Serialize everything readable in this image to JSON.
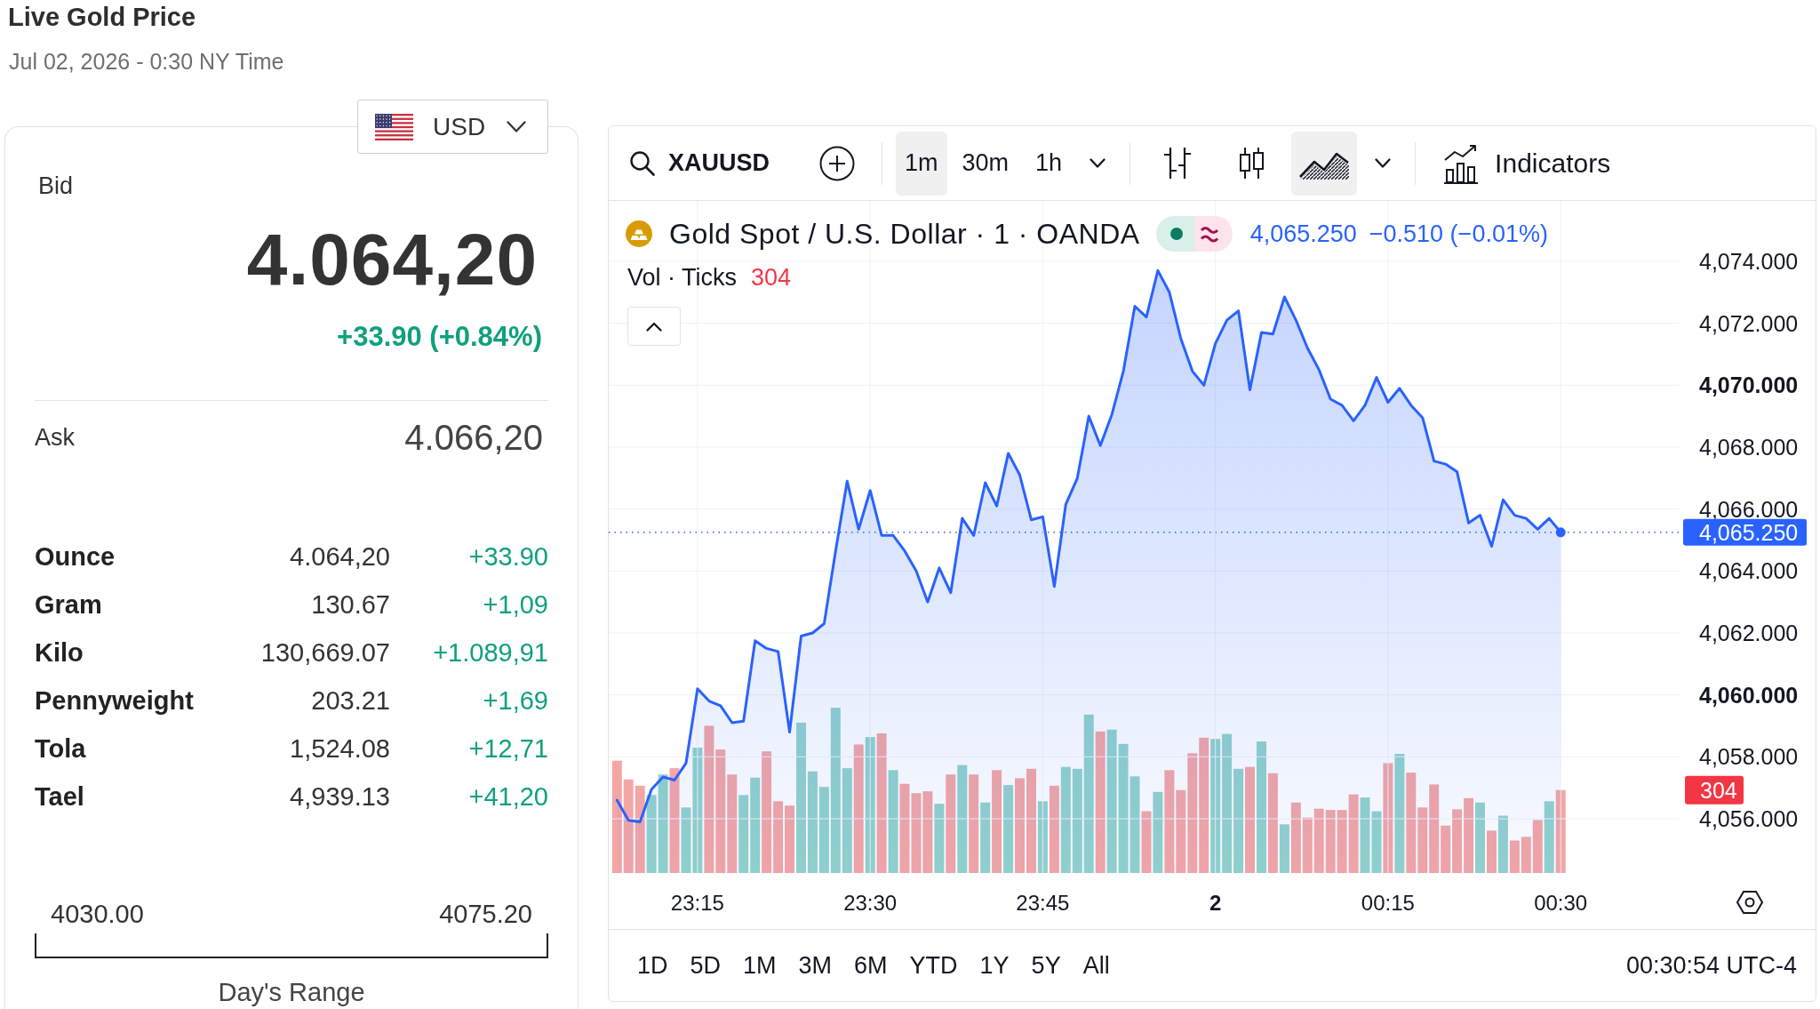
{
  "header": {
    "title": "Live Gold Price",
    "timestamp": "Jul 02, 2026 - 0:30 NY Time"
  },
  "currency": {
    "code": "USD"
  },
  "quote": {
    "bid_label": "Bid",
    "bid": "4.064,20",
    "change": "+33.90 (+0.84%)",
    "positive": true,
    "ask_label": "Ask",
    "ask": "4.066,20"
  },
  "units": [
    {
      "unit": "Ounce",
      "price": "4.064,20",
      "change": "+33.90",
      "positive": true
    },
    {
      "unit": "Gram",
      "price": "130.67",
      "change": "+1,09",
      "positive": true
    },
    {
      "unit": "Kilo",
      "price": "130,669.07",
      "change": "+1.089,91",
      "positive": true
    },
    {
      "unit": "Pennyweight",
      "price": "203.21",
      "change": "+1,69",
      "positive": true
    },
    {
      "unit": "Tola",
      "price": "1,524.08",
      "change": "+12,71",
      "positive": true
    },
    {
      "unit": "Tael",
      "price": "4,939.13",
      "change": "+41,20",
      "positive": true
    }
  ],
  "day_range": {
    "low": "4030.00",
    "high": "4075.20",
    "label": "Day's Range"
  },
  "chart": {
    "toolbar": {
      "symbol": "XAUUSD",
      "intervals": [
        {
          "label": "1m",
          "selected": true
        },
        {
          "label": "30m",
          "selected": false
        },
        {
          "label": "1h",
          "selected": false
        }
      ],
      "chart_types": [
        {
          "kind": "bars",
          "selected": false
        },
        {
          "kind": "candles",
          "selected": false
        },
        {
          "kind": "area",
          "selected": true
        }
      ],
      "indicators": "Indicators"
    },
    "legend": {
      "title": "Gold Spot / U.S. Dollar · 1 · OANDA",
      "price": "4,065.250",
      "change": "−0.510 (−0.01%)"
    },
    "volume_legend": {
      "label": "Vol · Ticks",
      "value": "304"
    },
    "price_tag": "4,065.250",
    "volume_tag": "304",
    "chart_data": {
      "type": "area",
      "x": [
        "2026-07-01T23:08",
        "2026-07-01T23:09",
        "2026-07-01T23:10",
        "2026-07-01T23:11",
        "2026-07-01T23:12",
        "2026-07-01T23:13",
        "2026-07-01T23:14",
        "2026-07-01T23:15",
        "2026-07-01T23:16",
        "2026-07-01T23:17",
        "2026-07-01T23:18",
        "2026-07-01T23:19",
        "2026-07-01T23:20",
        "2026-07-01T23:21",
        "2026-07-01T23:22",
        "2026-07-01T23:23",
        "2026-07-01T23:24",
        "2026-07-01T23:25",
        "2026-07-01T23:26",
        "2026-07-01T23:27",
        "2026-07-01T23:28",
        "2026-07-01T23:29",
        "2026-07-01T23:30",
        "2026-07-01T23:31",
        "2026-07-01T23:32",
        "2026-07-01T23:33",
        "2026-07-01T23:34",
        "2026-07-01T23:35",
        "2026-07-01T23:36",
        "2026-07-01T23:37",
        "2026-07-01T23:38",
        "2026-07-01T23:39",
        "2026-07-01T23:40",
        "2026-07-01T23:41",
        "2026-07-01T23:42",
        "2026-07-01T23:43",
        "2026-07-01T23:44",
        "2026-07-01T23:45",
        "2026-07-01T23:46",
        "2026-07-01T23:47",
        "2026-07-01T23:48",
        "2026-07-01T23:49",
        "2026-07-01T23:50",
        "2026-07-01T23:51",
        "2026-07-01T23:52",
        "2026-07-01T23:53",
        "2026-07-01T23:54",
        "2026-07-01T23:55",
        "2026-07-01T23:56",
        "2026-07-01T23:57",
        "2026-07-01T23:58",
        "2026-07-01T23:59",
        "2026-07-02T00:00",
        "2026-07-02T00:01",
        "2026-07-02T00:02",
        "2026-07-02T00:03",
        "2026-07-02T00:04",
        "2026-07-02T00:05",
        "2026-07-02T00:06",
        "2026-07-02T00:07",
        "2026-07-02T00:08",
        "2026-07-02T00:09",
        "2026-07-02T00:10",
        "2026-07-02T00:11",
        "2026-07-02T00:12",
        "2026-07-02T00:13",
        "2026-07-02T00:14",
        "2026-07-02T00:15",
        "2026-07-02T00:16",
        "2026-07-02T00:17",
        "2026-07-02T00:18",
        "2026-07-02T00:19",
        "2026-07-02T00:20",
        "2026-07-02T00:21",
        "2026-07-02T00:22",
        "2026-07-02T00:23",
        "2026-07-02T00:24",
        "2026-07-02T00:25",
        "2026-07-02T00:26",
        "2026-07-02T00:27",
        "2026-07-02T00:28",
        "2026-07-02T00:29",
        "2026-07-02T00:30"
      ],
      "series": [
        {
          "color": "#2962ff",
          "values": [
            4056.6,
            4055.95,
            4055.9,
            4056.95,
            4057.35,
            4057.25,
            4057.8,
            4060.2,
            4059.8,
            4059.65,
            4059.1,
            4059.15,
            4061.75,
            4061.5,
            4061.4,
            4058.8,
            4061.9,
            4062.0,
            4062.3,
            4064.65,
            4066.9,
            4065.35,
            4066.6,
            4065.15,
            4065.15,
            4064.65,
            4064.0,
            4063.0,
            4064.1,
            4063.3,
            4065.7,
            4065.15,
            4066.85,
            4066.1,
            4067.8,
            4067.1,
            4065.65,
            4065.75,
            4063.5,
            4066.15,
            4067.0,
            4069.0,
            4068.05,
            4069.05,
            4070.45,
            4072.55,
            4072.2,
            4073.7,
            4073.0,
            4071.5,
            4070.45,
            4070.0,
            4071.35,
            4072.1,
            4072.4,
            4069.85,
            4071.7,
            4071.65,
            4072.85,
            4072.1,
            4071.2,
            4070.5,
            4069.55,
            4069.35,
            4068.85,
            4069.35,
            4070.25,
            4069.45,
            4069.9,
            4069.35,
            4068.95,
            4067.55,
            4067.45,
            4067.2,
            4065.55,
            4065.8,
            4064.8,
            4066.3,
            4065.8,
            4065.7,
            4065.35,
            4065.7,
            4065.25
          ]
        }
      ],
      "xlim": [
        "2026-07-01T23:07:17",
        "2026-07-02T00:40:20"
      ],
      "ylim": [
        4054.25,
        4075.95
      ],
      "xticks": [
        {
          "value": "2026-07-01T23:15",
          "label": "23:15"
        },
        {
          "value": "2026-07-01T23:30",
          "label": "23:30"
        },
        {
          "value": "2026-07-01T23:45",
          "label": "23:45"
        },
        {
          "value": "2026-07-02T00:00",
          "label": "2"
        },
        {
          "value": "2026-07-02T00:15",
          "label": "00:15"
        },
        {
          "value": "2026-07-02T00:30",
          "label": "00:30"
        }
      ],
      "yticks": [
        {
          "value": 4074,
          "label": "4,074.000"
        },
        {
          "value": 4072,
          "label": "4,072.000"
        },
        {
          "value": 4070,
          "label": "4,070.000"
        },
        {
          "value": 4068,
          "label": "4,068.000"
        },
        {
          "value": 4066,
          "label": "4,066.000"
        },
        {
          "value": 4064,
          "label": "4,064.000"
        },
        {
          "value": 4062,
          "label": "4,062.000"
        },
        {
          "value": 4060,
          "label": "4,060.000"
        },
        {
          "value": 4058,
          "label": "4,058.000"
        },
        {
          "value": 4056,
          "label": "4,056.000"
        }
      ],
      "grid": true
    },
    "periods": [
      "1D",
      "5D",
      "1M",
      "3M",
      "6M",
      "YTD",
      "1Y",
      "5Y",
      "All"
    ],
    "clock": "00:30:54 UTC-4"
  }
}
